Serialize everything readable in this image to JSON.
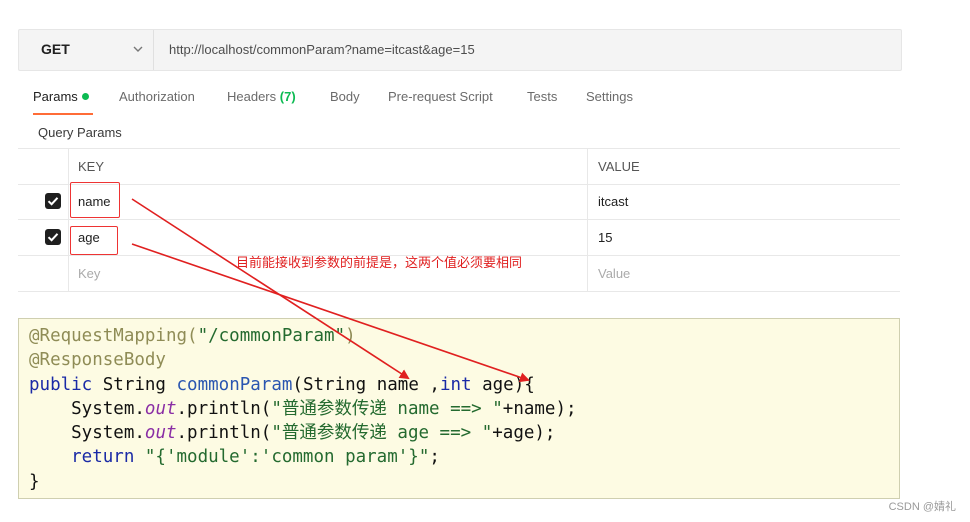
{
  "request": {
    "method": "GET",
    "url": "http://localhost/commonParam?name=itcast&age=15"
  },
  "tabs": [
    {
      "label": "Params"
    },
    {
      "label": "Authorization"
    },
    {
      "label": "Headers",
      "count": "(7)"
    },
    {
      "label": "Body"
    },
    {
      "label": "Pre-request Script"
    },
    {
      "label": "Tests"
    },
    {
      "label": "Settings"
    }
  ],
  "query_params": {
    "title": "Query Params",
    "headers": {
      "key": "KEY",
      "value": "VALUE"
    },
    "rows": [
      {
        "key": "name",
        "value": "itcast",
        "checked": true
      },
      {
        "key": "age",
        "value": "15",
        "checked": true
      }
    ],
    "placeholder": {
      "key": "Key",
      "value": "Value"
    }
  },
  "annotation": "目前能接收到参数的前提是，这两个值必须要相同",
  "code": {
    "line1_ann": "@RequestMapping(",
    "line1_str": "\"/commonParam\"",
    "line1_end": ")",
    "line2": "@ResponseBody",
    "line3_kw": "public",
    "line3_a": " String ",
    "line3_m": "commonParam",
    "line3_b": "(String name ,",
    "line3_kw2": "int",
    "line3_c": " age){",
    "line4_a": "    System.",
    "line4_f": "out",
    "line4_b": ".println(",
    "line4_s": "\"普通参数传递 name ==> \"",
    "line4_c": "+name);",
    "line5_a": "    System.",
    "line5_f": "out",
    "line5_b": ".println(",
    "line5_s": "\"普通参数传递 age ==> \"",
    "line5_c": "+age);",
    "line6_kw": "    return",
    "line6_s": " \"{'module':'common param'}\"",
    "line6_c": ";",
    "line7": "}"
  },
  "watermark": "CSDN @婧礼",
  "colors": {
    "accent": "#ff6c37",
    "status_dot": "#0cbb52",
    "annotation": "#e02020"
  }
}
